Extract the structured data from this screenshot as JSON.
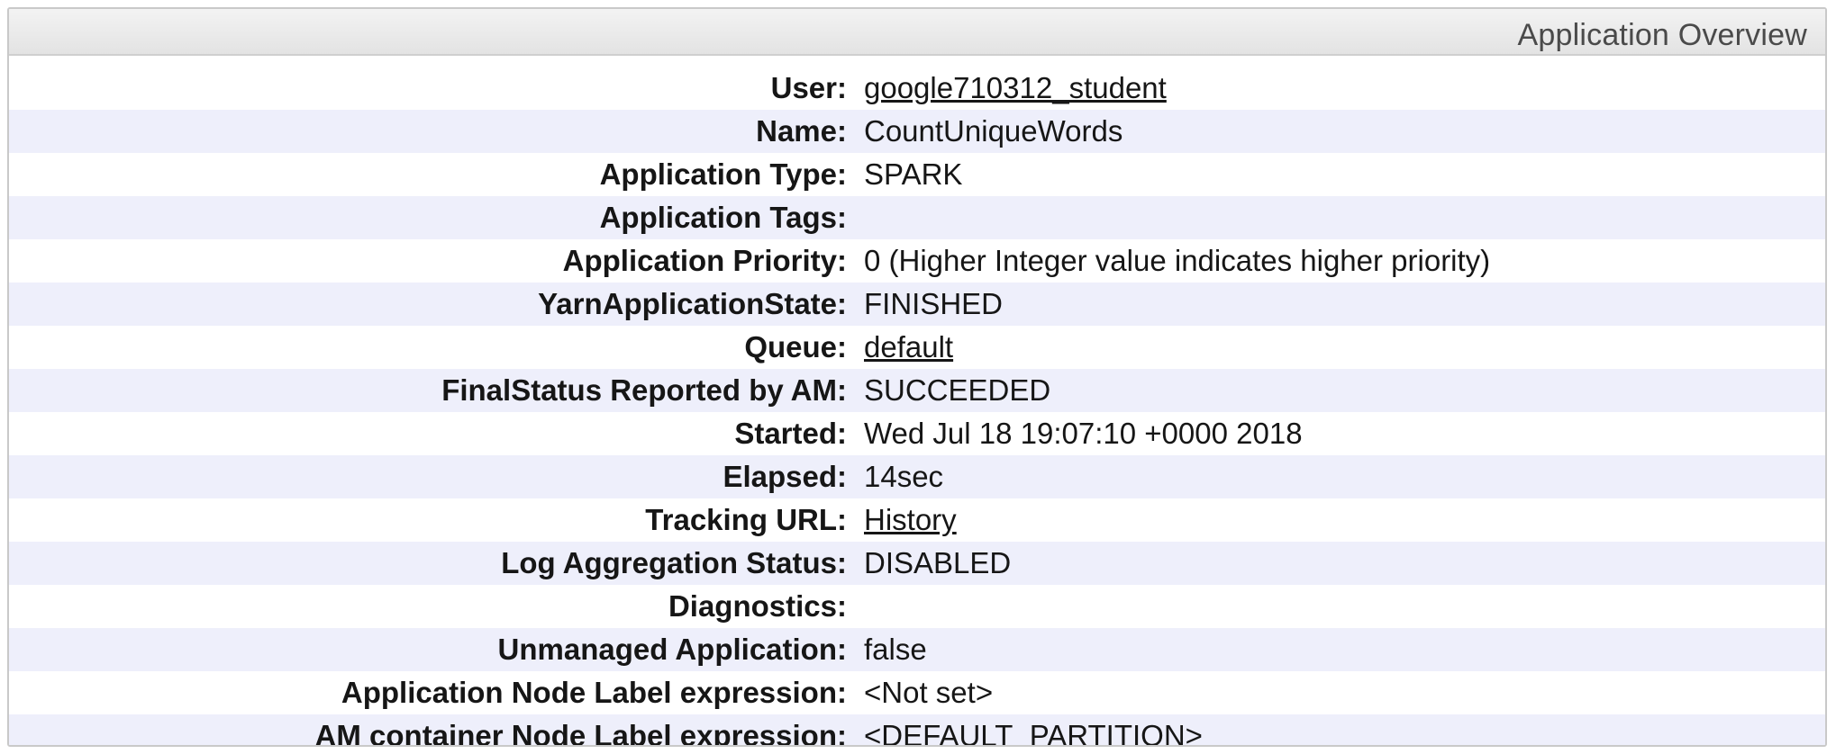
{
  "panel": {
    "title": "Application Overview"
  },
  "overview": {
    "rows": [
      {
        "label": "User:",
        "value": "google710312_student",
        "link": true
      },
      {
        "label": "Name:",
        "value": "CountUniqueWords",
        "link": false
      },
      {
        "label": "Application Type:",
        "value": "SPARK",
        "link": false
      },
      {
        "label": "Application Tags:",
        "value": "",
        "link": false
      },
      {
        "label": "Application Priority:",
        "value": "0 (Higher Integer value indicates higher priority)",
        "link": false
      },
      {
        "label": "YarnApplicationState:",
        "value": "FINISHED",
        "link": false
      },
      {
        "label": "Queue:",
        "value": "default",
        "link": true
      },
      {
        "label": "FinalStatus Reported by AM:",
        "value": "SUCCEEDED",
        "link": false
      },
      {
        "label": "Started:",
        "value": "Wed Jul 18 19:07:10 +0000 2018",
        "link": false
      },
      {
        "label": "Elapsed:",
        "value": "14sec",
        "link": false
      },
      {
        "label": "Tracking URL:",
        "value": "History",
        "link": true
      },
      {
        "label": "Log Aggregation Status:",
        "value": "DISABLED",
        "link": false
      },
      {
        "label": "Diagnostics:",
        "value": "",
        "link": false
      },
      {
        "label": "Unmanaged Application:",
        "value": "false",
        "link": false
      },
      {
        "label": "Application Node Label expression:",
        "value": "<Not set>",
        "link": false
      },
      {
        "label": "AM container Node Label expression:",
        "value": "<DEFAULT_PARTITION>",
        "link": false
      }
    ]
  }
}
